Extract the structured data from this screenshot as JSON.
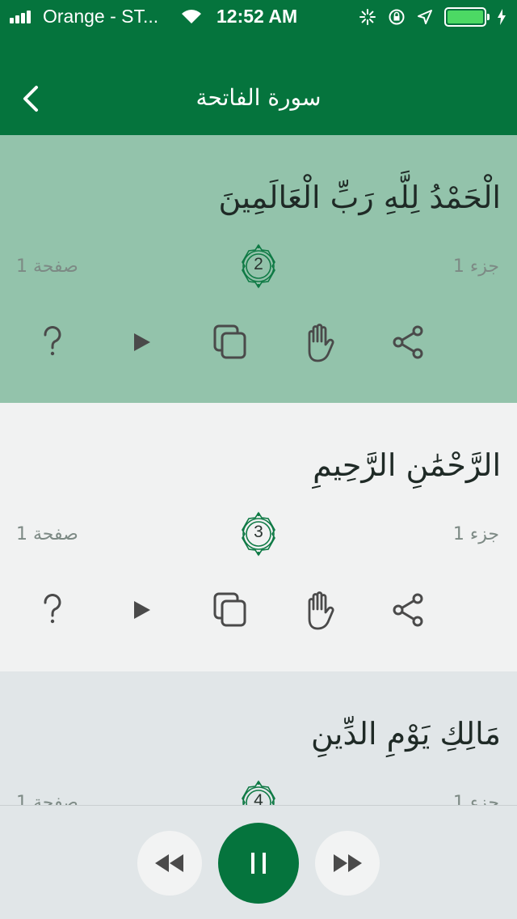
{
  "status_bar": {
    "carrier": "Orange - ST...",
    "time": "12:52 AM"
  },
  "header": {
    "title": "سورة الفاتحة",
    "back_icon": "chevron-left-icon"
  },
  "ayahs": [
    {
      "text": "الْحَمْدُ لِلَّهِ رَبِّ الْعَالَمِينَ",
      "number": "2",
      "page": "صفحة 1",
      "juz": "جزء 1",
      "highlighted": true
    },
    {
      "text": "الرَّحْمَٰنِ الرَّحِيمِ",
      "number": "3",
      "page": "صفحة 1",
      "juz": "جزء 1",
      "highlighted": false
    },
    {
      "text": "مَالِكِ يَوْمِ الدِّينِ",
      "number": "4",
      "page": "صفحة 1",
      "juz": "جزء 1",
      "highlighted": false
    }
  ],
  "actions": [
    "question-icon",
    "play-icon",
    "copy-icon",
    "hand-icon",
    "share-icon"
  ],
  "player": {
    "prev_icon": "rewind-icon",
    "main_icon": "pause-icon",
    "next_icon": "fast-forward-icon"
  },
  "colors": {
    "primary": "#05743d",
    "highlight": "#93c3ab",
    "battery": "#4cd964"
  }
}
